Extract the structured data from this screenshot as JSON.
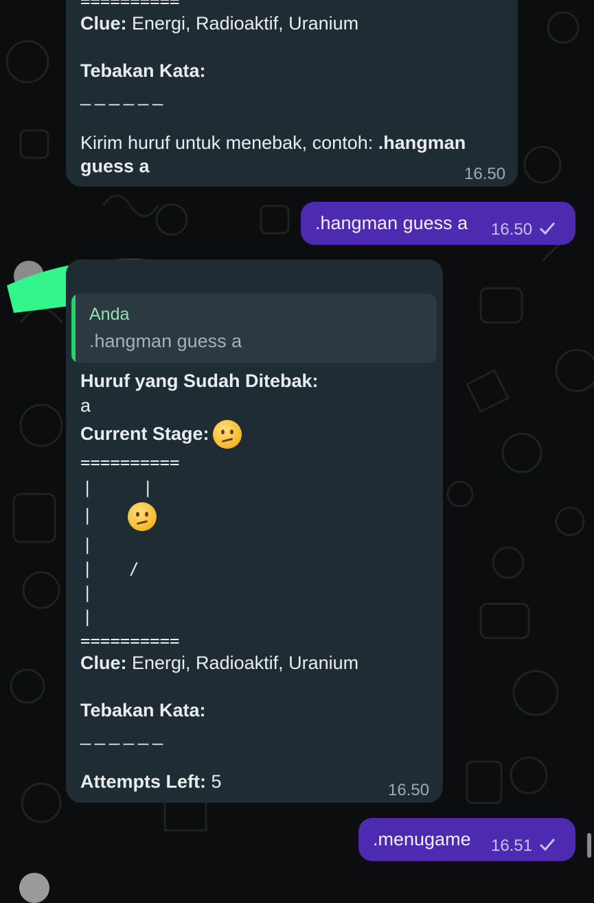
{
  "messages": {
    "top": {
      "clue_label": "Clue:",
      "clue_text": " Energi, Radioaktif, Uranium",
      "tebakan_label": "Tebakan Kata:",
      "blanks": "______",
      "instruction_text": "Kirim huruf untuk menebak, contoh: ",
      "instruction_cmd_1": ".hangman",
      "instruction_cmd_2": "guess a",
      "time": "16.50"
    },
    "sent1": {
      "text": ".hangman guess a",
      "time": "16.50"
    },
    "bot": {
      "quote_author": "Anda",
      "quote_text": ".hangman guess a",
      "guessed_label": "Huruf yang Sudah Ditebak:",
      "guessed_value": "a",
      "stage_label": "Current Stage:",
      "art_line": "==========",
      "art_bar": "|",
      "art_leg": "/",
      "clue_label": "Clue:",
      "clue_text": " Energi, Radioaktif, Uranium",
      "tebakan_label": "Tebakan Kata:",
      "blanks": "______",
      "attempts_label": "Attempts Left:",
      "attempts_value": " 5",
      "time": "16.50"
    },
    "sent2": {
      "text": ".menugame",
      "time": "16.51"
    }
  },
  "colors": {
    "incoming_bubble": "#202c33",
    "outgoing_bubble": "#4c2bb0",
    "quote_accent": "#25d366",
    "highlight_scribble": "#34f58c"
  },
  "icons": [
    "read-check-icon",
    "confused-face-emoji",
    "avatar"
  ]
}
